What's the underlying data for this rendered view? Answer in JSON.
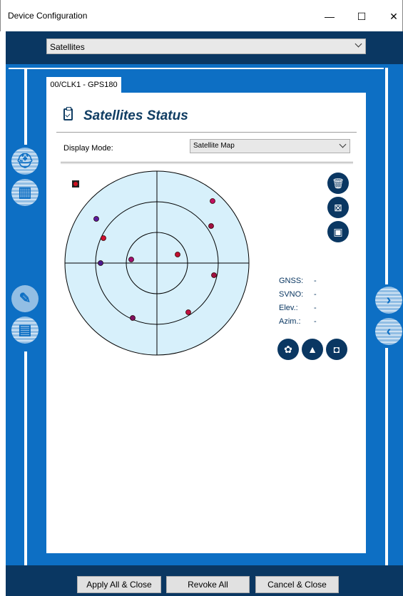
{
  "window": {
    "title": "Device Configuration",
    "min_glyph": "—",
    "max_glyph": "☐",
    "close_glyph": "✕"
  },
  "topbar": {
    "selected": "Satellites"
  },
  "tab": {
    "label": "00/CLK1 - GPS180"
  },
  "panel": {
    "heading": "Satellites Status",
    "display_mode_label": "Display Mode:",
    "display_mode_value": "Satellite Map"
  },
  "info": {
    "gnss_label": "GNSS:",
    "gnss_value": "-",
    "svno_label": "SVNO:",
    "svno_value": "-",
    "elev_label": "Elev.:",
    "elev_value": "-",
    "azim_label": "Azim.:",
    "azim_value": "-"
  },
  "footer": {
    "apply_label": "Apply All & Close",
    "revoke_label": "Revoke All",
    "cancel_label": "Cancel & Close"
  },
  "icons": {
    "side_left": [
      "helmet-icon",
      "report-icon",
      "wrench-icon",
      "clipboard-icon"
    ],
    "side_right": [
      "next-icon",
      "back-icon"
    ],
    "plot_tools": [
      "delete-icon",
      "fit-icon",
      "save-icon"
    ],
    "bottom_tools": [
      "palette-icon",
      "terrain-icon",
      "stop-icon"
    ]
  }
}
